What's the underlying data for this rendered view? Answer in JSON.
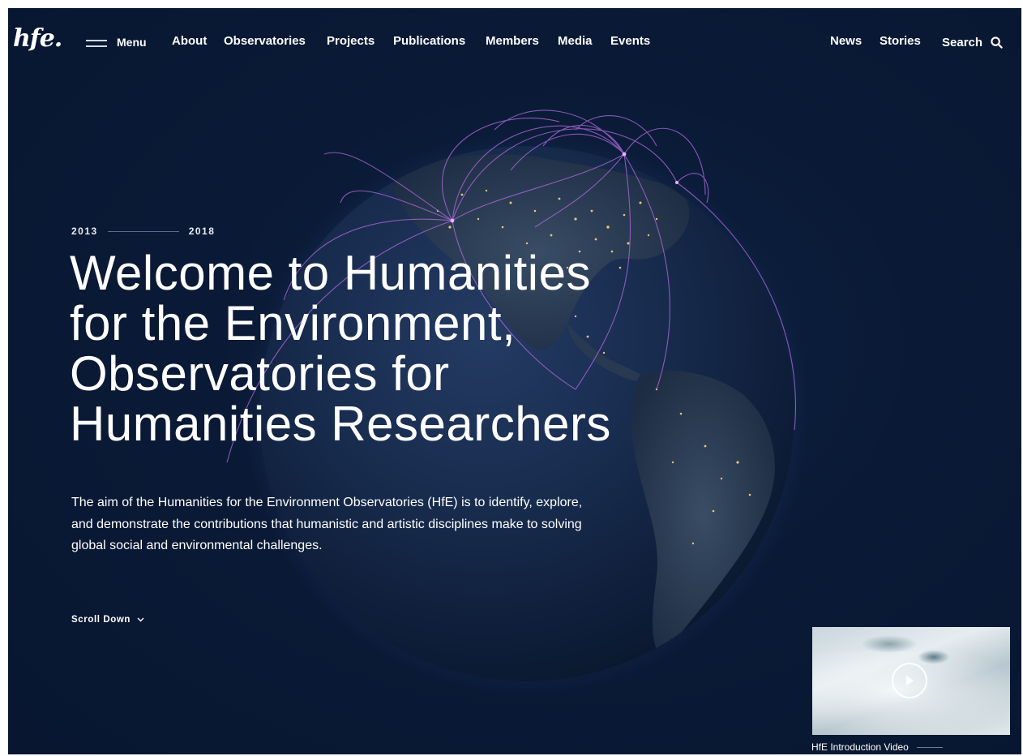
{
  "header": {
    "logo_text": "hfe.",
    "menu_label": "Menu",
    "nav_left": [
      "About",
      "Observatories",
      "Projects",
      "Publications",
      "Members",
      "Media",
      "Events"
    ],
    "nav_right": [
      "News",
      "Stories"
    ],
    "search_label": "Search"
  },
  "hero": {
    "year_start": "2013",
    "year_end": "2018",
    "title_lines": [
      "Welcome to Humanities",
      "for the Environment,",
      "Observatories for",
      "Humanities Researchers"
    ],
    "description": "The aim of the Humanities for the Environment Observatories (HfE) is to identify, explore, and demonstrate the contributions that humanistic and artistic disciplines make to solving global social and environmental challenges.",
    "scroll_label": "Scroll Down"
  },
  "video": {
    "caption": "HfE Introduction Video"
  },
  "colors": {
    "background": "#0a1a36",
    "text": "#ffffff",
    "arc_accent": "#b46be0",
    "city_lights": "#f0c070"
  },
  "icons": {
    "menu": "hamburger-icon",
    "search": "search-icon",
    "scroll": "chevron-down-icon",
    "play": "play-icon"
  }
}
